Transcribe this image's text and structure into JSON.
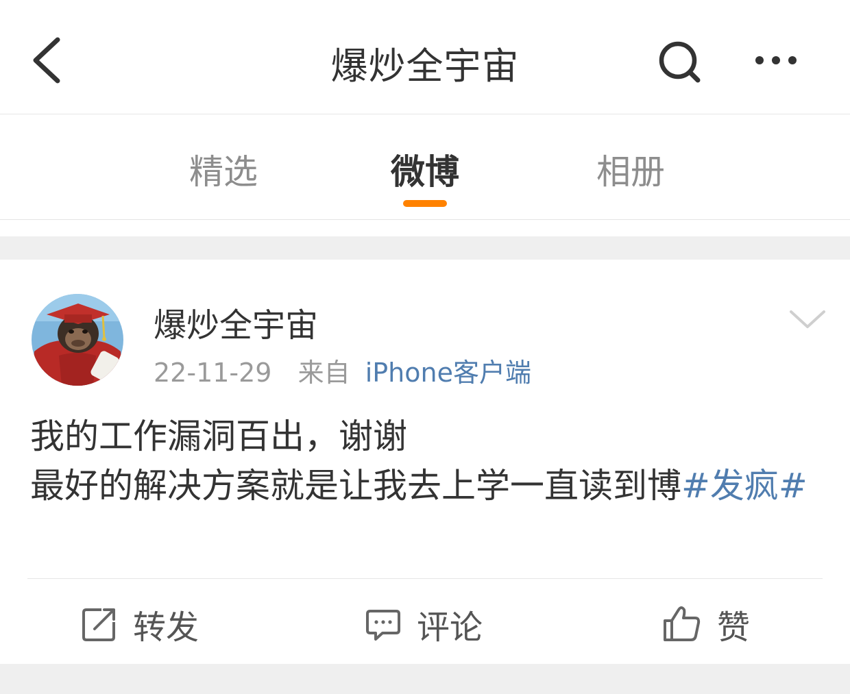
{
  "header": {
    "title": "爆炒全宇宙",
    "back_icon": "chevron-left-icon",
    "search_icon": "search-icon",
    "more_icon": "more-dots-icon"
  },
  "tabs": [
    {
      "label": "精选",
      "active": false
    },
    {
      "label": "微博",
      "active": true
    },
    {
      "label": "相册",
      "active": false
    }
  ],
  "colors": {
    "accent": "#ff8200",
    "link": "#507daf",
    "text": "#333333",
    "muted": "#9a9a9a"
  },
  "post": {
    "author": "爆炒全宇宙",
    "date": "22-11-29",
    "from_label": "来自",
    "source": "iPhone客户端",
    "text_line1": "我的工作漏洞百出，谢谢",
    "text_line2": "最好的解决方案就是让我去上学一直读到博",
    "topic": "#发疯#",
    "actions": {
      "repost": "转发",
      "comment": "评论",
      "like": "赞"
    }
  }
}
